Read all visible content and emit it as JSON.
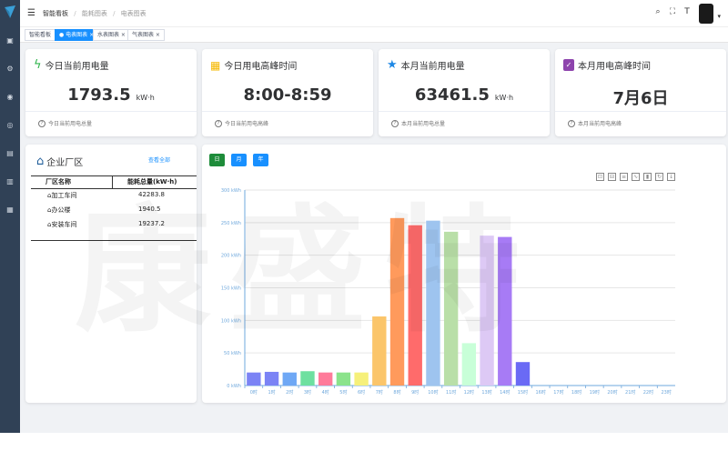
{
  "header": {
    "breadcrumb": [
      "智能看板",
      "能耗图表",
      "电表图表"
    ]
  },
  "tags": [
    {
      "label": "智能看板",
      "active": false
    },
    {
      "label": "电表图表",
      "active": true
    },
    {
      "label": "水表图表",
      "active": false
    },
    {
      "label": "气表图表",
      "active": false
    }
  ],
  "stats": [
    {
      "title": "今日当前用电量",
      "value": "1793.5",
      "unit": "kW·h",
      "foot": "今日当前用电总量",
      "icon": "lightning-icon",
      "color": "#2fb44c"
    },
    {
      "title": "今日用电高峰时间",
      "value": "8:00-8:59",
      "unit": "",
      "foot": "今日当前用电高峰",
      "icon": "calendar-icon",
      "color": "#f5b800"
    },
    {
      "title": "本月当前用电量",
      "value": "63461.5",
      "unit": "kW·h",
      "foot": "本月当前用电总量",
      "icon": "star-icon",
      "color": "#1e88e5"
    },
    {
      "title": "本月用电高峰时间",
      "value": "7月6日",
      "unit": "",
      "foot": "本月当前用电高峰",
      "icon": "clipboard-icon",
      "color": "#8e44ad"
    }
  ],
  "factory": {
    "title": "企业厂区",
    "link": "查看全部",
    "columns": [
      "厂区名称",
      "能耗总量(kW·h)"
    ],
    "rows": [
      {
        "name": "加工车间",
        "value": "42283.8"
      },
      {
        "name": "办公楼",
        "value": "1940.5"
      },
      {
        "name": "安装车间",
        "value": "19237.2"
      }
    ]
  },
  "period_buttons": [
    {
      "label": "日",
      "color": "#1e8c3a"
    },
    {
      "label": "月",
      "color": "#1890ff"
    },
    {
      "label": "年",
      "color": "#1890ff"
    }
  ],
  "watermark": "康盛特",
  "chart_data": {
    "type": "bar",
    "categories": [
      "0时",
      "1时",
      "2时",
      "3时",
      "4时",
      "5时",
      "6时",
      "7时",
      "8时",
      "9时",
      "10时",
      "11时",
      "12时",
      "13时",
      "14时",
      "15时",
      "16时",
      "17时",
      "18时",
      "19时",
      "20时",
      "21时",
      "22时",
      "23时"
    ],
    "values": [
      20,
      21,
      20,
      22,
      20,
      20,
      20,
      106,
      257,
      246,
      253,
      236,
      65,
      230,
      228,
      36,
      0,
      0,
      0,
      0,
      0,
      0,
      0,
      0
    ],
    "colors": [
      "#7b83f5",
      "#7b83f5",
      "#6fa8f5",
      "#6ee0a0",
      "#ff7b9a",
      "#8be38b",
      "#f6f07a",
      "#fbc56a",
      "#ff9a5c",
      "#ff6b6b",
      "#9ec4ef",
      "#b9dfa8",
      "#c8ffd8",
      "#ddc9f5",
      "#a77bf5",
      "#6a6af5",
      "#6a6af5",
      "#6a6af5",
      "#6a6af5",
      "#6a6af5",
      "#6a6af5",
      "#6a6af5",
      "#6a6af5",
      "#6a6af5"
    ],
    "yticks": [
      "0 kWh",
      "50 kWh",
      "100 kWh",
      "150 kWh",
      "200 kWh",
      "250 kWh",
      "300 kWh"
    ],
    "ylim": [
      0,
      300
    ]
  }
}
